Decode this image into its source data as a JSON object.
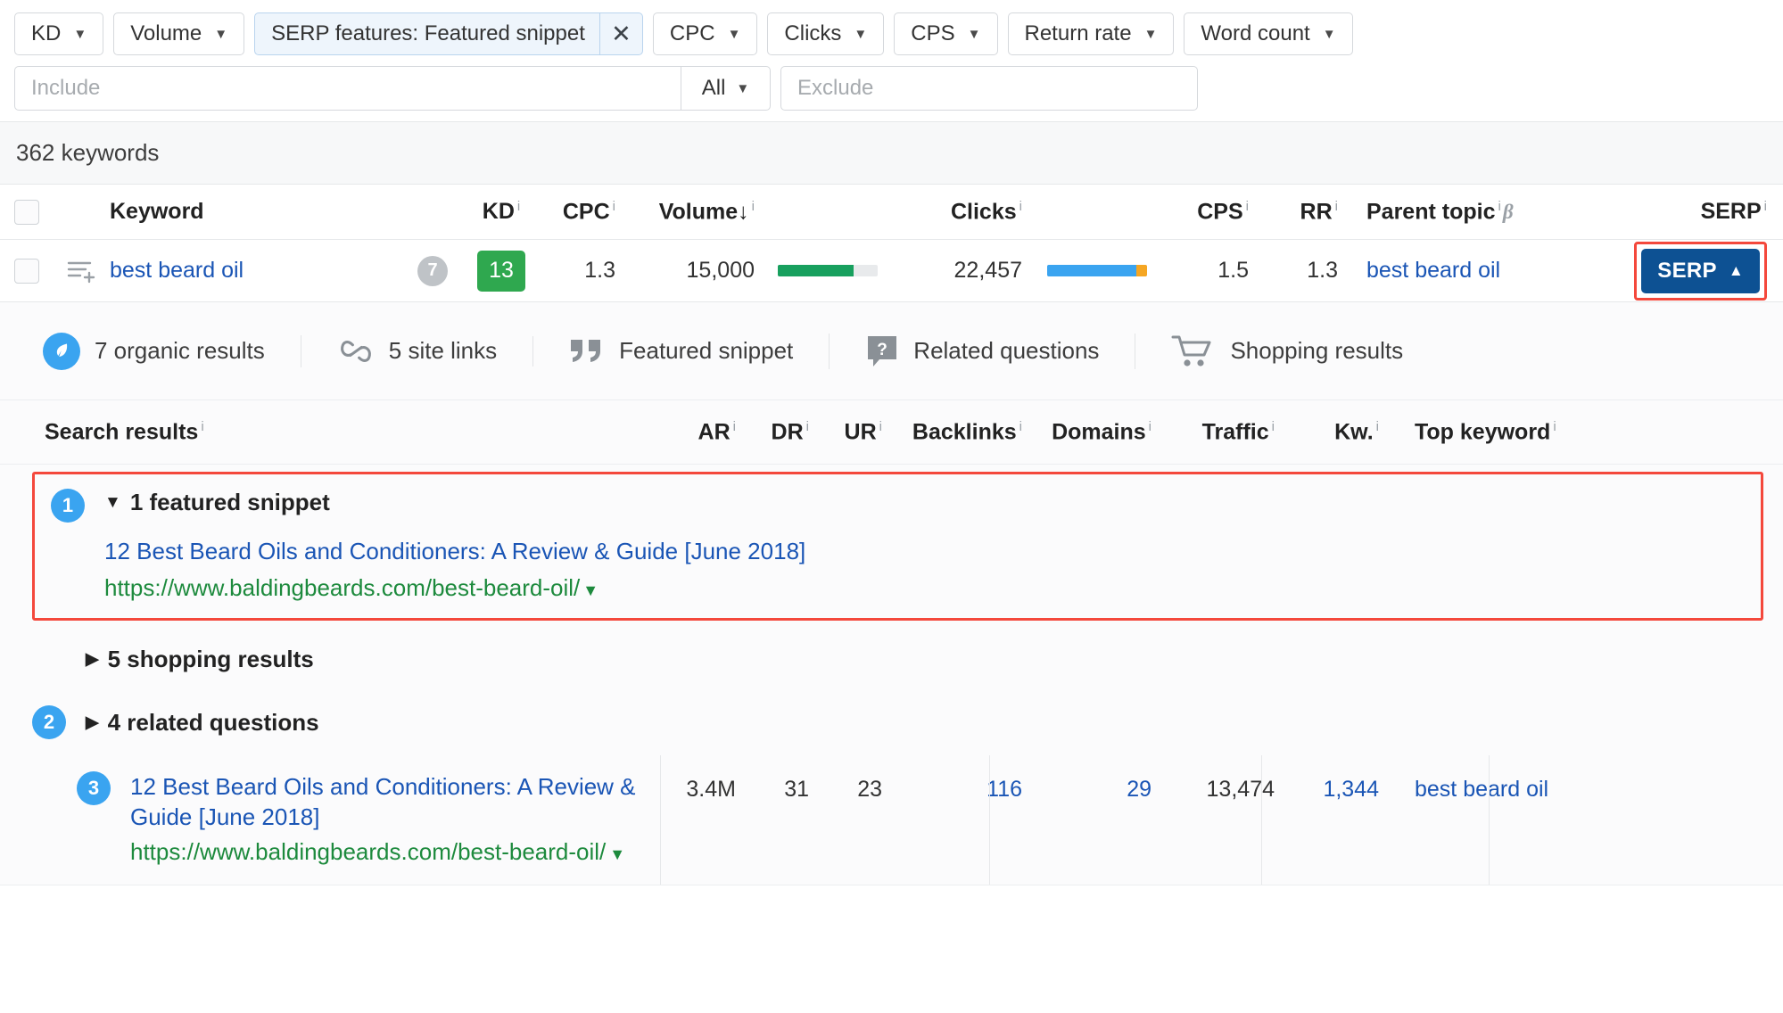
{
  "filters": {
    "buttons": [
      {
        "label": "KD",
        "caret": "▼"
      },
      {
        "label": "Volume",
        "caret": "▼"
      }
    ],
    "active_filter": {
      "label": "SERP features: Featured snippet",
      "close": "✕"
    },
    "buttons_after": [
      {
        "label": "CPC",
        "caret": "▼"
      },
      {
        "label": "Clicks",
        "caret": "▼"
      },
      {
        "label": "CPS",
        "caret": "▼"
      },
      {
        "label": "Return rate",
        "caret": "▼"
      },
      {
        "label": "Word count",
        "caret": "▼"
      }
    ],
    "include_placeholder": "Include",
    "all_label": "All",
    "all_caret": "▼",
    "exclude_placeholder": "Exclude",
    "include_value": "",
    "exclude_value": ""
  },
  "count_strip": {
    "text": "362 keywords"
  },
  "keyword_table": {
    "headers": {
      "keyword": "Keyword",
      "kd": "KD",
      "cpc": "CPC",
      "volume": "Volume",
      "volume_sort": "↓",
      "clicks": "Clicks",
      "cps": "CPS",
      "rr": "RR",
      "parent_topic": "Parent topic",
      "parent_beta": "β",
      "serp": "SERP",
      "info": "i"
    },
    "row": {
      "keyword": "best beard oil",
      "lists_count": "7",
      "kd": "13",
      "kd_color": "#2fa84f",
      "cpc": "1.3",
      "volume": "15,000",
      "volume_bar_pct": 76,
      "volume_bar_color": "#18a05e",
      "clicks": "22,457",
      "clicks_bar_pct": 89,
      "clicks_bar_color": "#3aa4f0",
      "clicks_bar_color2": "#f5a623",
      "cps": "1.5",
      "rr": "1.3",
      "parent_topic": "best beard oil",
      "serp_button": "SERP",
      "serp_caret": "▲"
    }
  },
  "serp_panel": {
    "features": [
      {
        "icon": "organic-leaf-icon",
        "label": "7 organic results"
      },
      {
        "icon": "site-links-icon",
        "label": "5 site links"
      },
      {
        "icon": "featured-snippet-quote-icon",
        "label": "Featured snippet"
      },
      {
        "icon": "related-questions-icon",
        "label": "Related questions"
      },
      {
        "icon": "shopping-cart-icon",
        "label": "Shopping results"
      }
    ],
    "headers": {
      "search_results": "Search results",
      "ar": "AR",
      "dr": "DR",
      "ur": "UR",
      "backlinks": "Backlinks",
      "domains": "Domains",
      "traffic": "Traffic",
      "kw": "Kw.",
      "top_keyword": "Top keyword",
      "info": "i"
    },
    "featured_snippet": {
      "rank": "1",
      "toggle": "▼",
      "group_label": "1 featured snippet",
      "title": "12 Best Beard Oils and Conditioners: A Review & Guide [June 2018]",
      "url": "https://www.baldingbeards.com/best-beard-oil/",
      "url_caret": "▼"
    },
    "shopping_group": {
      "toggle": "▶",
      "label": "5 shopping results"
    },
    "related_questions_group": {
      "rank": "2",
      "toggle": "▶",
      "label": "4 related questions"
    },
    "organic_result": {
      "rank": "3",
      "title": "12 Best Beard Oils and Conditioners: A Review & Guide [June 2018]",
      "url": "https://www.baldingbeards.com/best-beard-oil/",
      "url_caret": "▼",
      "ar": "3.4M",
      "dr": "31",
      "ur": "23",
      "backlinks": "116",
      "domains": "29",
      "traffic": "13,474",
      "kw": "1,344",
      "top_keyword": "best beard oil"
    }
  },
  "colors": {
    "link": "#1a55b5",
    "url_green": "#1d8a3d",
    "serp_blue": "#0d5193",
    "highlight_red": "#f4483c",
    "rank_blue": "#3aa4f0",
    "kd_green": "#2fa84f"
  }
}
